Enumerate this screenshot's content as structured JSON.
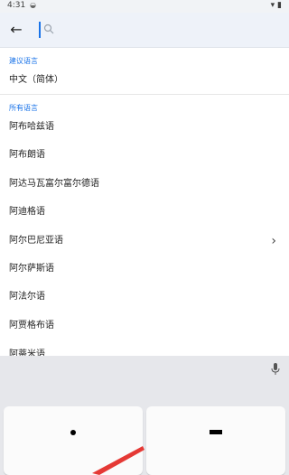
{
  "status_bar": {
    "time": "4:31"
  },
  "search": {
    "placeholder": "",
    "value": ""
  },
  "suggested": {
    "header": "建议语言",
    "items": [
      {
        "label": "中文（简体）"
      }
    ]
  },
  "all_languages": {
    "header": "所有语言",
    "items": [
      {
        "label": "阿布哈兹语"
      },
      {
        "label": "阿布朗语"
      },
      {
        "label": "阿达马瓦富尔富尔德语"
      },
      {
        "label": "阿迪格语"
      },
      {
        "label": "阿尔巴尼亚语"
      },
      {
        "label": "阿尔萨斯语"
      },
      {
        "label": "阿法尔语"
      },
      {
        "label": "阿贾格布语"
      },
      {
        "label": "阿蒂米语"
      }
    ]
  },
  "colors": {
    "accent": "#1a73e8",
    "toolbar_bg": "#eef2f9",
    "keyboard_bg": "#e6e7eb",
    "arrow": "#e53935"
  }
}
